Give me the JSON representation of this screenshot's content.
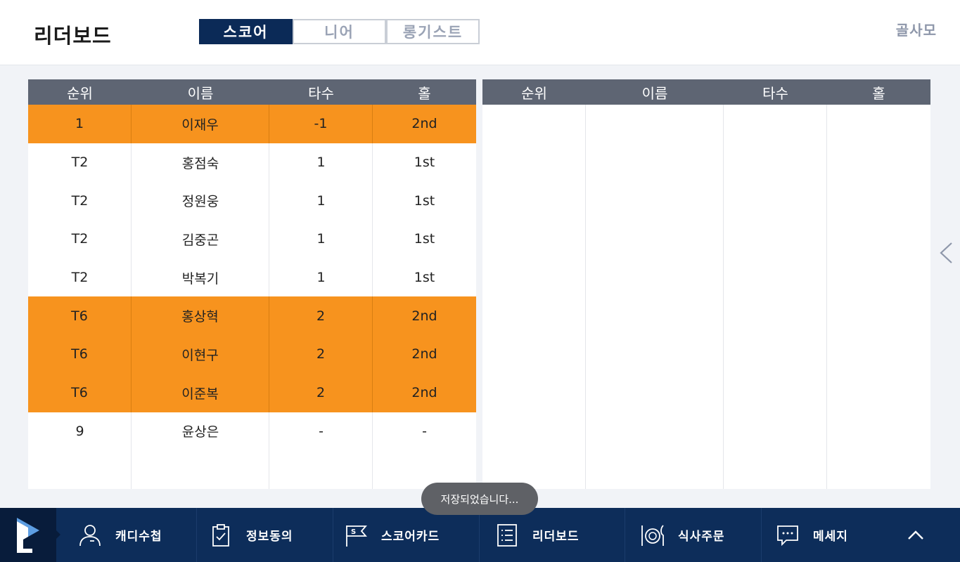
{
  "header": {
    "title": "리더보드",
    "tabs": [
      {
        "label": "스코어",
        "active": true
      },
      {
        "label": "니어",
        "active": false
      },
      {
        "label": "롱기스트",
        "active": false
      }
    ],
    "club_name": "골사모"
  },
  "leaderboard": {
    "columns": [
      "순위",
      "이름",
      "타수",
      "홀"
    ],
    "left_rows": [
      {
        "rank": "1",
        "name": "이재우",
        "score": "-1",
        "hole": "2nd",
        "highlight": true
      },
      {
        "rank": "T2",
        "name": "홍점숙",
        "score": "1",
        "hole": "1st",
        "highlight": false
      },
      {
        "rank": "T2",
        "name": "정원웅",
        "score": "1",
        "hole": "1st",
        "highlight": false
      },
      {
        "rank": "T2",
        "name": "김중곤",
        "score": "1",
        "hole": "1st",
        "highlight": false
      },
      {
        "rank": "T2",
        "name": "박복기",
        "score": "1",
        "hole": "1st",
        "highlight": false
      },
      {
        "rank": "T6",
        "name": "홍상혁",
        "score": "2",
        "hole": "2nd",
        "highlight": true
      },
      {
        "rank": "T6",
        "name": "이현구",
        "score": "2",
        "hole": "2nd",
        "highlight": true
      },
      {
        "rank": "T6",
        "name": "이준복",
        "score": "2",
        "hole": "2nd",
        "highlight": true
      },
      {
        "rank": "9",
        "name": "윤상은",
        "score": "-",
        "hole": "-",
        "highlight": false
      }
    ],
    "right_rows": []
  },
  "toast": "저장되었습니다...",
  "bottom_nav": [
    {
      "label": "캐디수첩",
      "icon": "caddie-person-icon"
    },
    {
      "label": "정보동의",
      "icon": "clipboard-check-icon"
    },
    {
      "label": "스코어카드",
      "icon": "scorecard-flag-icon"
    },
    {
      "label": "리더보드",
      "icon": "list-icon"
    },
    {
      "label": "식사주문",
      "icon": "meal-icon"
    },
    {
      "label": "메세지",
      "icon": "message-icon"
    }
  ],
  "colors": {
    "highlight": "#f7931e",
    "header_bg": "#5e6573",
    "nav_bg": "#0d2d5a",
    "tab_active": "#0b2a57"
  }
}
